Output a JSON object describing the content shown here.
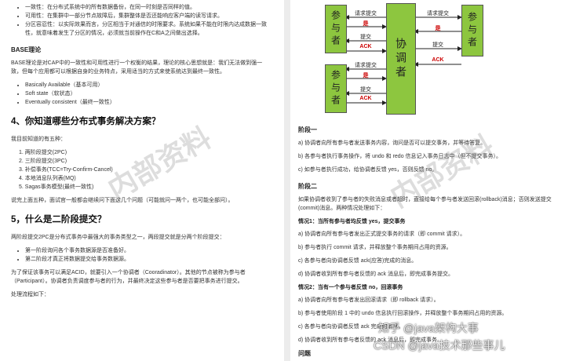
{
  "left": {
    "intro_bullets": [
      "一致性：在分布式系统中的所有数据备份，在同一时刻是否同样的值。",
      "可用性：在集群中一部分节点故障后，集群整体是否还能响应客户端的读写请求。",
      "分区容忍性：以实际效果而言，分区相当于对通信的时限要求。系统如果不能在时限内达成数据一致性，就意味着发生了分区的情况，必须就当前操作在C和A之间做出选择。"
    ],
    "base_title": "BASE理论",
    "base_para": "BASE理论是对CAP中的一致性和可用性进行一个权衡的结果，理论的核心思想就是：我们无法做到强一致，但每个应用都可以根据自身的业务特点，采用适当的方式来使系统达到最终一致性。",
    "base_bullets": [
      "Basically Available（基本可用）",
      "Soft state（软状态）",
      "Eventually consistent（最终一致性）"
    ],
    "q4_title": "4、你知道哪些分布式事务解决方案？",
    "q4_intro": "我目前知道的有五种：",
    "q4_items": [
      "1. 两阶段提交(2PC)",
      "2. 三阶段提交(3PC)",
      "3. 补偿事务(TCC=Try-Confirm-Cancel)",
      "4. 本地消息队列表(MQ)",
      "5. Sagas事务模型(最终一致性)"
    ],
    "q4_outro": "说完上面五种，面试官一般都会继续问下面这几个问题（可能就问一两个，也可能全部问）。",
    "q5_title": "5，什么是二阶段提交？",
    "q5_intro": "两阶段提交2PC是分布式事务中最强大的事务类型之一，两段提交就是分两个阶段提交：",
    "q5_bullets": [
      "第一阶段询问各个事务数据源是否准备好。",
      "第二阶段才真正将数据提交给事务数据源。"
    ],
    "q5_para": "为了保证该事务可以满足ACID，就要引入一个协调者（Cooradinator）。其他的节点被称为参与者（Participant）。协调者负责调度参与者的行为，并最终决定这些参与者是否要把事务进行提交。",
    "q5_flow": "处理流程如下："
  },
  "diagram": {
    "participant": "参与者",
    "coordinator": "协调者",
    "labels": {
      "request_commit": "请求提交",
      "yes": "是",
      "commit": "提交",
      "ack": "ACK"
    }
  },
  "right": {
    "phase1_title": "阶段一",
    "phase1_items": [
      "a) 协调者向所有参与者发送事务内容，询问是否可以提交事务，并等待答复。",
      "b) 各参与者执行事务操作，将 undo 和 redo 信息记入事务日志中（但不提交事务）。",
      "c) 如参与者执行成功，给协调者反馈 yes，否则反馈 no。"
    ],
    "phase2_title": "阶段二",
    "phase2_intro": "如果协调者收到了参与者的失败消息或者超时，直接给每个参与者发送回滚(rollback)消息；否则发送提交(commit)消息。两种情况处理如下：",
    "case1_title": "情况1：当所有参与者均反馈 yes，提交事务",
    "case1_items": [
      "a) 协调者向所有参与者发出正式提交事务的请求（即 commit 请求）。",
      "b) 参与者执行 commit 请求，并释放整个事务期间占用的资源。",
      "c) 各参与者向协调者反馈 ack(应答)完成的消息。",
      "d) 协调者收到所有参与者反馈的 ack 消息后，即完成事务提交。"
    ],
    "case2_title": "情况2：当有一个参与者反馈 no，回滚事务",
    "case2_items": [
      "a) 协调者向所有参与者发出回滚请求（即 rollback 请求）。",
      "b) 参与者使用阶段 1 中的 undo 信息执行回滚操作，并释放整个事务期间占用的资源。",
      "c) 各参与者向协调者反馈 ack 完成的消息。",
      "d) 协调者收到所有参与者反馈的 ack 消息后，即完成事务。"
    ],
    "problems_title": "问题"
  },
  "watermarks": {
    "wm1": "内部资料",
    "wm2": "内部资料",
    "footer1": "知乎 @java架构大事",
    "footer2": "CSDN @java技术那些事儿"
  }
}
